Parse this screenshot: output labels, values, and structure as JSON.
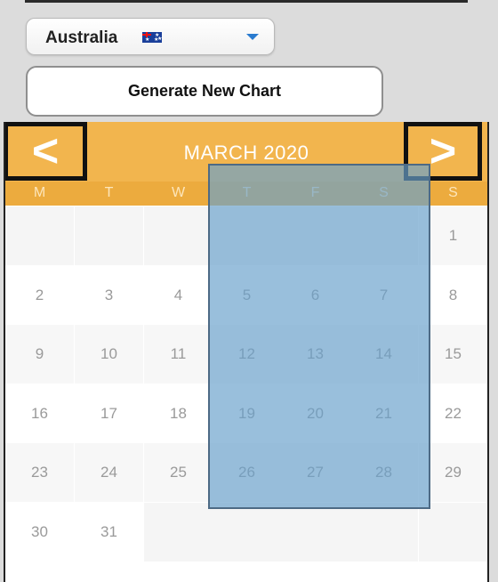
{
  "country_select": {
    "value": "Australia",
    "flag": "australia-flag-icon"
  },
  "generate_button": {
    "label": "Generate New Chart"
  },
  "calendar": {
    "title": "MARCH 2020",
    "prev_label": "<",
    "next_label": ">",
    "weekdays": [
      "M",
      "T",
      "W",
      "T",
      "F",
      "S",
      "S"
    ],
    "weeks": [
      [
        "",
        "",
        "",
        "",
        "",
        "",
        "1"
      ],
      [
        "2",
        "3",
        "4",
        "5",
        "6",
        "7",
        "8"
      ],
      [
        "9",
        "10",
        "11",
        "12",
        "13",
        "14",
        "15"
      ],
      [
        "16",
        "17",
        "18",
        "19",
        "20",
        "21",
        "22"
      ],
      [
        "23",
        "24",
        "25",
        "26",
        "27",
        "28",
        "29"
      ],
      [
        "30",
        "31",
        "",
        "",
        "",
        "",
        ""
      ]
    ]
  },
  "colors": {
    "header": "#f2b54e",
    "weekday_bar": "#ecab3e",
    "highlight": "#68a0cc"
  }
}
